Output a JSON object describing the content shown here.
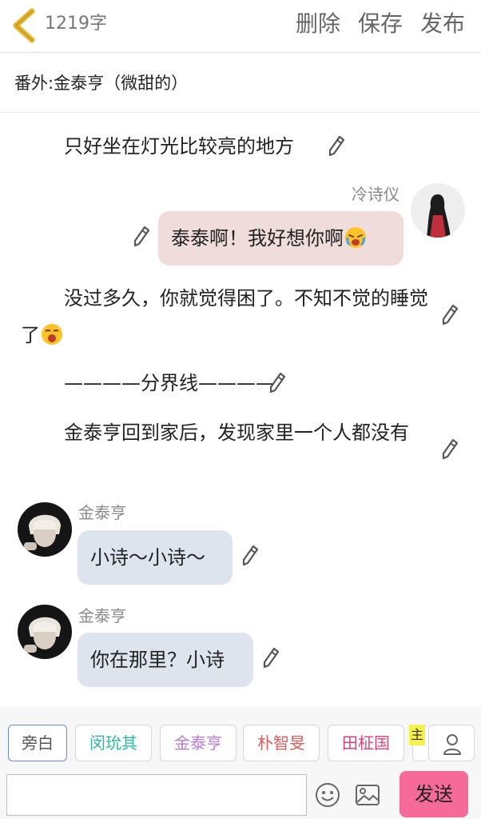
{
  "header": {
    "word_count": "1219字",
    "delete_label": "删除",
    "save_label": "保存",
    "publish_label": "发布"
  },
  "story": {
    "title": "番外:金泰亨（微甜的）"
  },
  "messages": {
    "narration_1": "只好坐在灯光比较亮的地方",
    "user_name": "冷诗仪",
    "user_msg": "泰泰啊！我好想你啊",
    "narration_2": "没过多久，你就觉得困了。不知不觉的睡觉了",
    "narration_3": "————分界线————",
    "narration_4": "金泰亨回到家后，发现家里一个人都没有",
    "char_name_1": "金泰亨",
    "char_msg_1": "小诗～小诗～",
    "char_name_2": "金泰亨",
    "char_msg_2": "你在那里？小诗"
  },
  "toolbar": {
    "chips": [
      "旁白",
      "闵玧其",
      "金泰亨",
      "朴智旻",
      "田柾国"
    ],
    "main_tag": "主",
    "input_value": "",
    "send_label": "发送"
  },
  "colors": {
    "back_arrow": "#e3b62f",
    "right_bubble": "#f1dcdc",
    "left_bubble": "#dde4ee",
    "send_button": "#f66a9a"
  }
}
